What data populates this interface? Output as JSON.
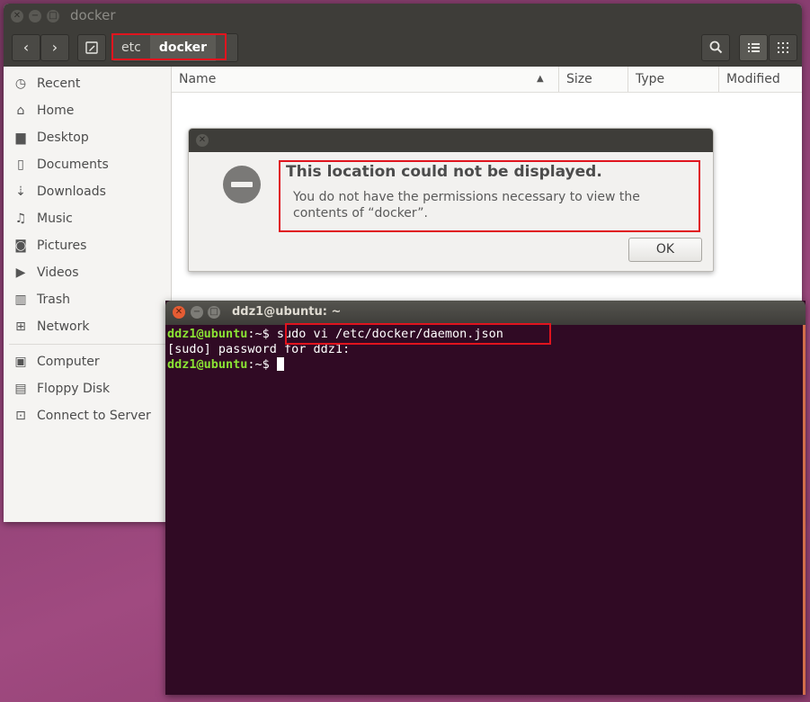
{
  "file_manager": {
    "title": "docker",
    "breadcrumb": [
      {
        "label": "etc"
      },
      {
        "label": "docker"
      }
    ],
    "sidebar": {
      "places": [
        {
          "label": "Recent",
          "icon": "clock-icon"
        },
        {
          "label": "Home",
          "icon": "home-icon"
        },
        {
          "label": "Desktop",
          "icon": "folder-icon"
        },
        {
          "label": "Documents",
          "icon": "document-icon"
        },
        {
          "label": "Downloads",
          "icon": "download-icon"
        },
        {
          "label": "Music",
          "icon": "music-icon"
        },
        {
          "label": "Pictures",
          "icon": "camera-icon"
        },
        {
          "label": "Videos",
          "icon": "video-icon"
        },
        {
          "label": "Trash",
          "icon": "trash-icon"
        },
        {
          "label": "Network",
          "icon": "network-icon"
        }
      ],
      "devices": [
        {
          "label": "Computer",
          "icon": "computer-icon"
        },
        {
          "label": "Floppy Disk",
          "icon": "floppy-icon"
        },
        {
          "label": "Connect to Server",
          "icon": "server-icon"
        }
      ]
    },
    "columns": [
      "Name",
      "Size",
      "Type",
      "Modified"
    ]
  },
  "dialog": {
    "title": "This location could not be displayed.",
    "message": "You do not have the permissions necessary to view the contents of “docker”.",
    "ok_label": "OK"
  },
  "terminal": {
    "title": "ddz1@ubuntu: ~",
    "prompt_user": "ddz1@ubuntu",
    "prompt_sep": ":~$ ",
    "line1_cmd": "sudo vi /etc/docker/daemon.json",
    "line2": "[sudo] password for ddz1:"
  }
}
